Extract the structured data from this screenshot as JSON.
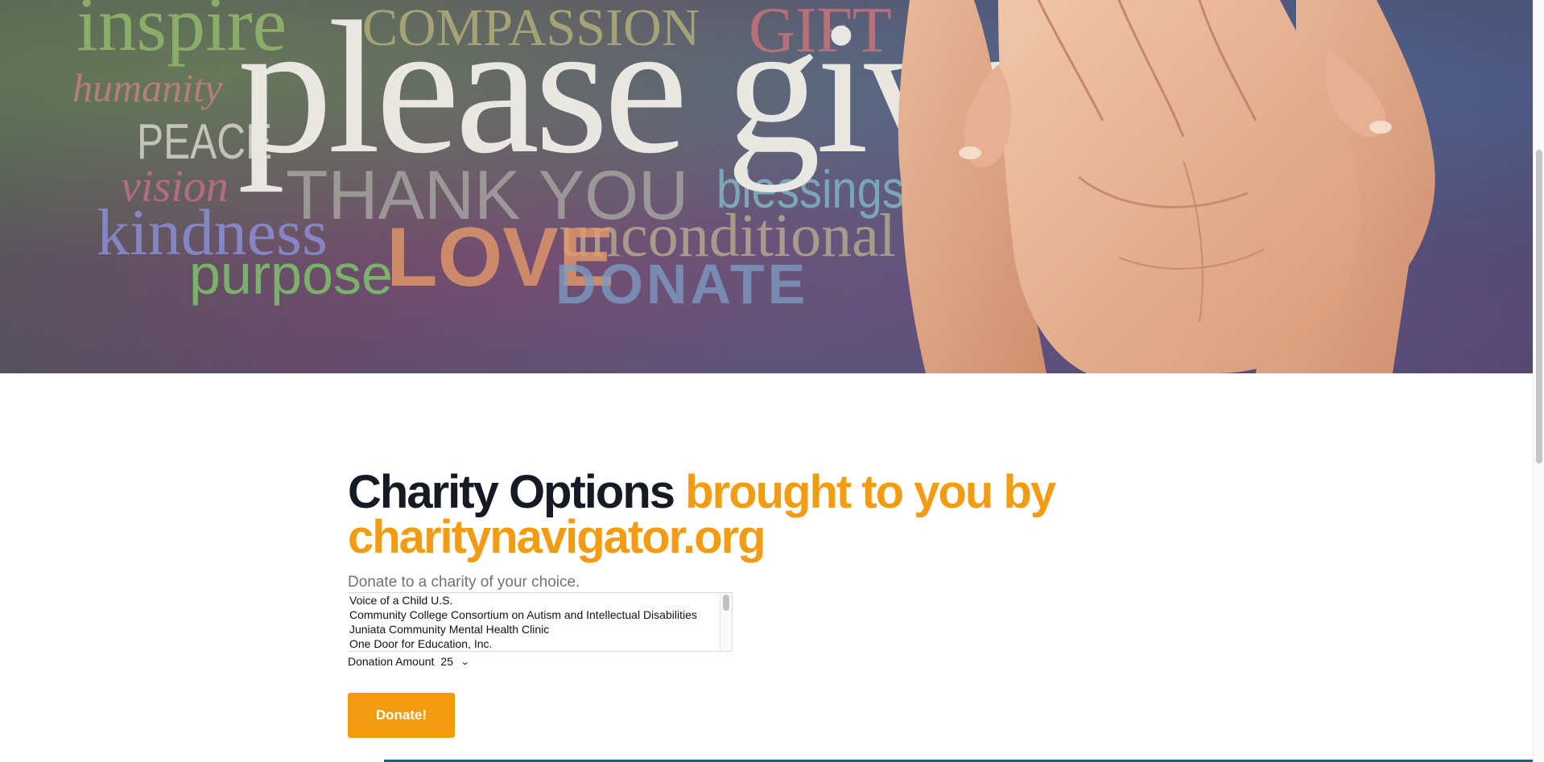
{
  "hero": {
    "words": {
      "inspire": "inspire",
      "compassion": "COMPASSION",
      "gift": "GIFT",
      "humanity": "humanity",
      "please_give": "please give",
      "peace": "PEACE",
      "vision": "vision",
      "thank_you": "THANK YOU",
      "blessings": "blessings",
      "kindness": "kindness",
      "unconditional": "unconditional",
      "purpose": "purpose",
      "love": "LOVE",
      "donate": "DONATE"
    }
  },
  "content": {
    "title_main": "Charity Options",
    "title_accent": "brought to you by charitynavigator.org",
    "intro": "Donate to a charity of your choice.",
    "charities": [
      "Voice of a Child U.S.",
      "Community College Consortium on Autism and Intellectual Disabilities",
      "Juniata Community Mental Health Clinic",
      "One Door for Education, Inc."
    ],
    "amount_label": "Donation Amount",
    "amount_value": "25",
    "donate_button": "Donate!"
  },
  "colors": {
    "accent": "#f39c12",
    "heading": "#161a24",
    "muted": "#6b7280"
  }
}
